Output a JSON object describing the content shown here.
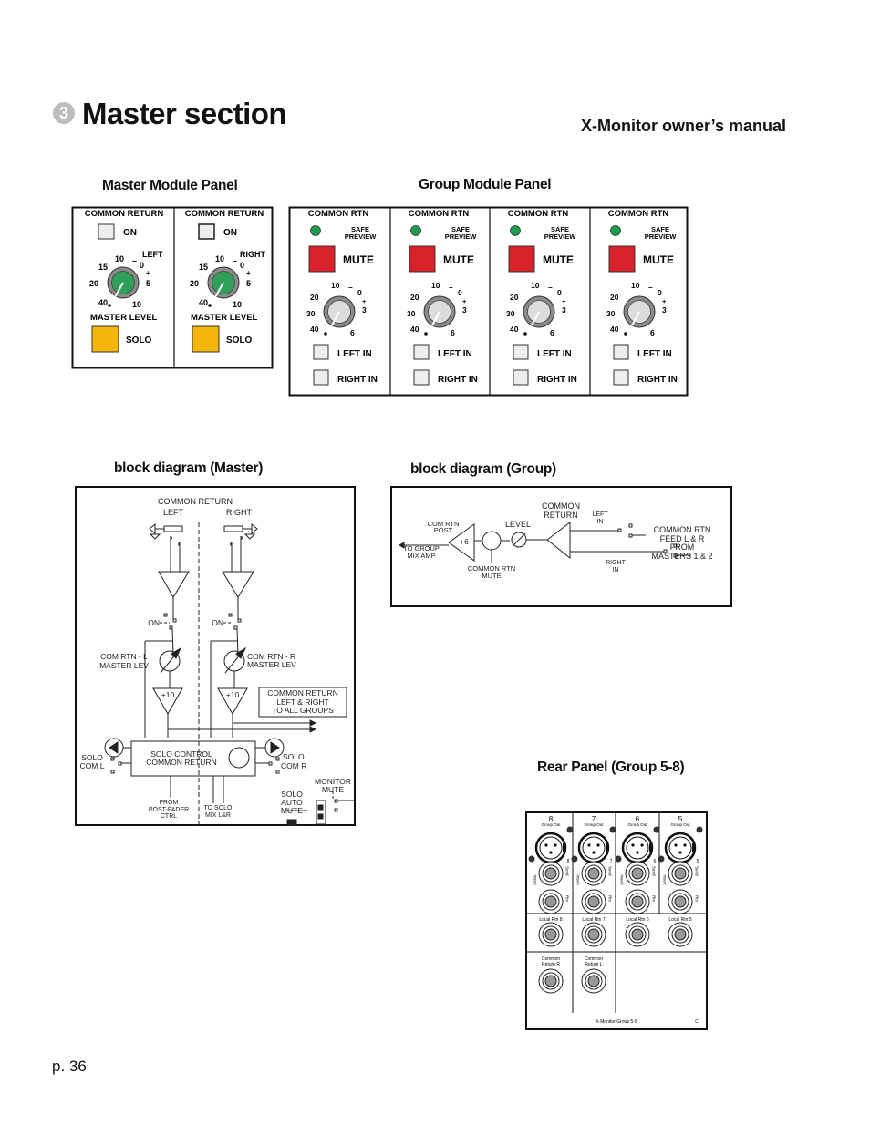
{
  "header": {
    "section_number": "3",
    "title": "Master section",
    "manual_title": "X-Monitor owner’s manual"
  },
  "headings": {
    "master_panel": "Master Module Panel",
    "group_panel": "Group Module Panel",
    "block_master": "block diagram (Master)",
    "block_group": "block diagram (Group)",
    "rear_panel": "Rear Panel (Group 5-8)"
  },
  "master_panel": {
    "channels": [
      {
        "header": "COMMON RETURN",
        "on_label": "ON",
        "side_label": "LEFT",
        "level_label": "MASTER LEVEL",
        "solo_label": "SOLO"
      },
      {
        "header": "COMMON RETURN",
        "on_label": "ON",
        "side_label": "RIGHT",
        "level_label": "MASTER LEVEL",
        "solo_label": "SOLO"
      }
    ],
    "scale": {
      "s10": "10",
      "dash": "–",
      "s0": "0",
      "plus": "+",
      "s5": "5",
      "s15": "15",
      "s20": "20",
      "s40": "40",
      "s10b": "10"
    },
    "colors": {
      "knob": "#2fa05a",
      "solo": "#f5b50a"
    }
  },
  "group_panel": {
    "channels": [
      {
        "header": "COMMON RTN",
        "led_label_1": "SAFE",
        "led_label_2": "PREVIEW",
        "mute_label": "MUTE",
        "left_in": "LEFT IN",
        "right_in": "RIGHT IN"
      },
      {
        "header": "COMMON RTN",
        "led_label_1": "SAFE",
        "led_label_2": "PREVIEW",
        "mute_label": "MUTE",
        "left_in": "LEFT IN",
        "right_in": "RIGHT IN"
      },
      {
        "header": "COMMON RTN",
        "led_label_1": "SAFE",
        "led_label_2": "PREVIEW",
        "mute_label": "MUTE",
        "left_in": "LEFT IN",
        "right_in": "RIGHT IN"
      },
      {
        "header": "COMMON RTN",
        "led_label_1": "SAFE",
        "led_label_2": "PREVIEW",
        "mute_label": "MUTE",
        "left_in": "LEFT IN",
        "right_in": "RIGHT IN"
      }
    ],
    "scale": {
      "s10": "10",
      "dash": "–",
      "s0": "0",
      "plus": "+",
      "s3": "3",
      "s20": "20",
      "s30": "30",
      "s40": "40",
      "s6": "6"
    },
    "colors": {
      "led": "#1e9b4b",
      "mute": "#d8222a"
    }
  },
  "block_master": {
    "common_return": "COMMON RETURN",
    "left": "LEFT",
    "right": "RIGHT",
    "on_l": "ON",
    "on_r": "ON",
    "lev_l_1": "COM RTN - L",
    "lev_l_2": "MASTER LEV",
    "lev_r_1": "COM RTN - R",
    "lev_r_2": "MASTER LEV",
    "gain_l": "+10",
    "gain_r": "+10",
    "to_groups_1": "COMMON  RETURN",
    "to_groups_2": "LEFT & RIGHT",
    "to_groups_3": "TO ALL GROUPS",
    "solo_ctrl_1": "SOLO CONTROL",
    "solo_ctrl_2": "COMMON RETURN",
    "solo_l_1": "SOLO",
    "solo_l_2": "COM L",
    "solo_r_1": "SOLO",
    "solo_r_2": "COM R",
    "from_1": "FROM",
    "from_2": "POST-FADER",
    "from_3": "CTRL",
    "to_solo_1": "TO SOLO",
    "to_solo_2": "MIX L&R",
    "auto_1": "SOLO",
    "auto_2": "AUTO",
    "auto_3": "MUTE",
    "monitor_1": "MONITOR",
    "monitor_2": "MUTE"
  },
  "block_group": {
    "post_1": "COM RTN",
    "post_2": "POST",
    "gain": "+6",
    "to_group_1": "TO GROUP",
    "to_group_2": "MIX AMP",
    "mute_1": "COMMON RTN",
    "mute_2": "MUTE",
    "level": "LEVEL",
    "cr_1": "COMMON",
    "cr_2": "RETURN",
    "left_1": "LEFT",
    "left_2": "IN",
    "right_1": "RIGHT",
    "right_2": "IN",
    "feed_1": "COMMON RTN",
    "feed_2": "FEED L & R",
    "feed_3": "FROM",
    "feed_4": "MASTERS 1 & 2"
  },
  "rear_panel": {
    "channels": [
      {
        "number": "8",
        "group_out": "Group Out",
        "send": "Send",
        "rtn": "Rtn",
        "insert": "Insert",
        "local_rtn": "Local Rtn 8"
      },
      {
        "number": "7",
        "group_out": "Group Out",
        "send": "Send",
        "rtn": "Rtn",
        "insert": "Insert",
        "local_rtn": "Local Rtn 7"
      },
      {
        "number": "6",
        "group_out": "Group Out",
        "send": "Send",
        "rtn": "Rtn",
        "insert": "Insert",
        "local_rtn": "Local Rtn 6"
      },
      {
        "number": "5",
        "group_out": "Group Out",
        "send": "Send",
        "rtn": "Rtn",
        "insert": "Insert",
        "local_rtn": "Local Rtn 5"
      }
    ],
    "common_r_1": "Common",
    "common_r_2": "Return R",
    "common_l_1": "Common",
    "common_l_2": "Return L",
    "footer": "X-Monitor Group 5-8",
    "ce_mark": "C"
  },
  "footer": {
    "page": "p. 36"
  }
}
